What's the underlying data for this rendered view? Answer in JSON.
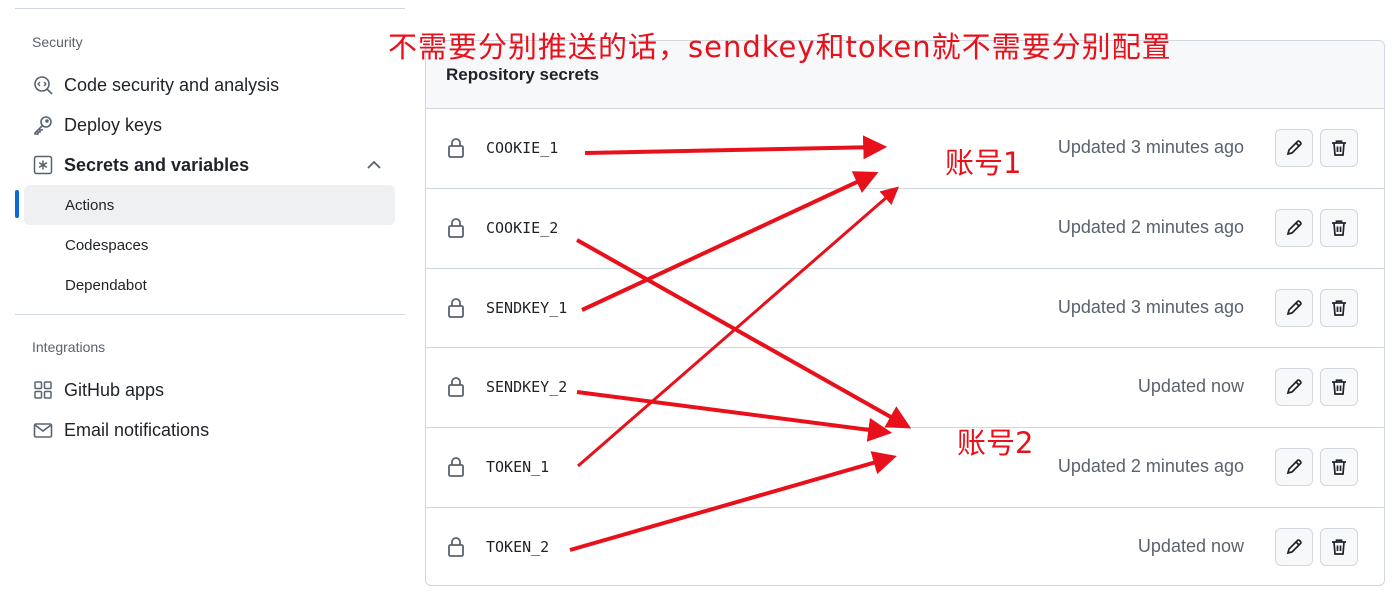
{
  "sidebar": {
    "security_title": "Security",
    "items": [
      {
        "label": "Code security and analysis",
        "icon": "codescan-icon"
      },
      {
        "label": "Deploy keys",
        "icon": "key-icon"
      },
      {
        "label": "Secrets and variables",
        "icon": "asterisk-icon",
        "expanded": true
      }
    ],
    "sub_items": [
      {
        "label": "Actions",
        "active": true
      },
      {
        "label": "Codespaces",
        "active": false
      },
      {
        "label": "Dependabot",
        "active": false
      }
    ],
    "integrations_title": "Integrations",
    "integrations": [
      {
        "label": "GitHub apps",
        "icon": "apps-icon"
      },
      {
        "label": "Email notifications",
        "icon": "mail-icon"
      }
    ]
  },
  "panel": {
    "title": "Repository secrets",
    "secrets": [
      {
        "name": "COOKIE_1",
        "updated": "Updated 3 minutes ago"
      },
      {
        "name": "COOKIE_2",
        "updated": "Updated 2 minutes ago"
      },
      {
        "name": "SENDKEY_1",
        "updated": "Updated 3 minutes ago"
      },
      {
        "name": "SENDKEY_2",
        "updated": "Updated now"
      },
      {
        "name": "TOKEN_1",
        "updated": "Updated 2 minutes ago"
      },
      {
        "name": "TOKEN_2",
        "updated": "Updated now"
      }
    ]
  },
  "annotations": {
    "top_note": "不需要分别推送的话，sendkey和token就不需要分别配置",
    "account1": "账号1",
    "account2": "账号2",
    "color": "#e8101a"
  },
  "colors": {
    "accent": "#0969da",
    "muted": "#59636e",
    "border": "#d0d7de"
  }
}
